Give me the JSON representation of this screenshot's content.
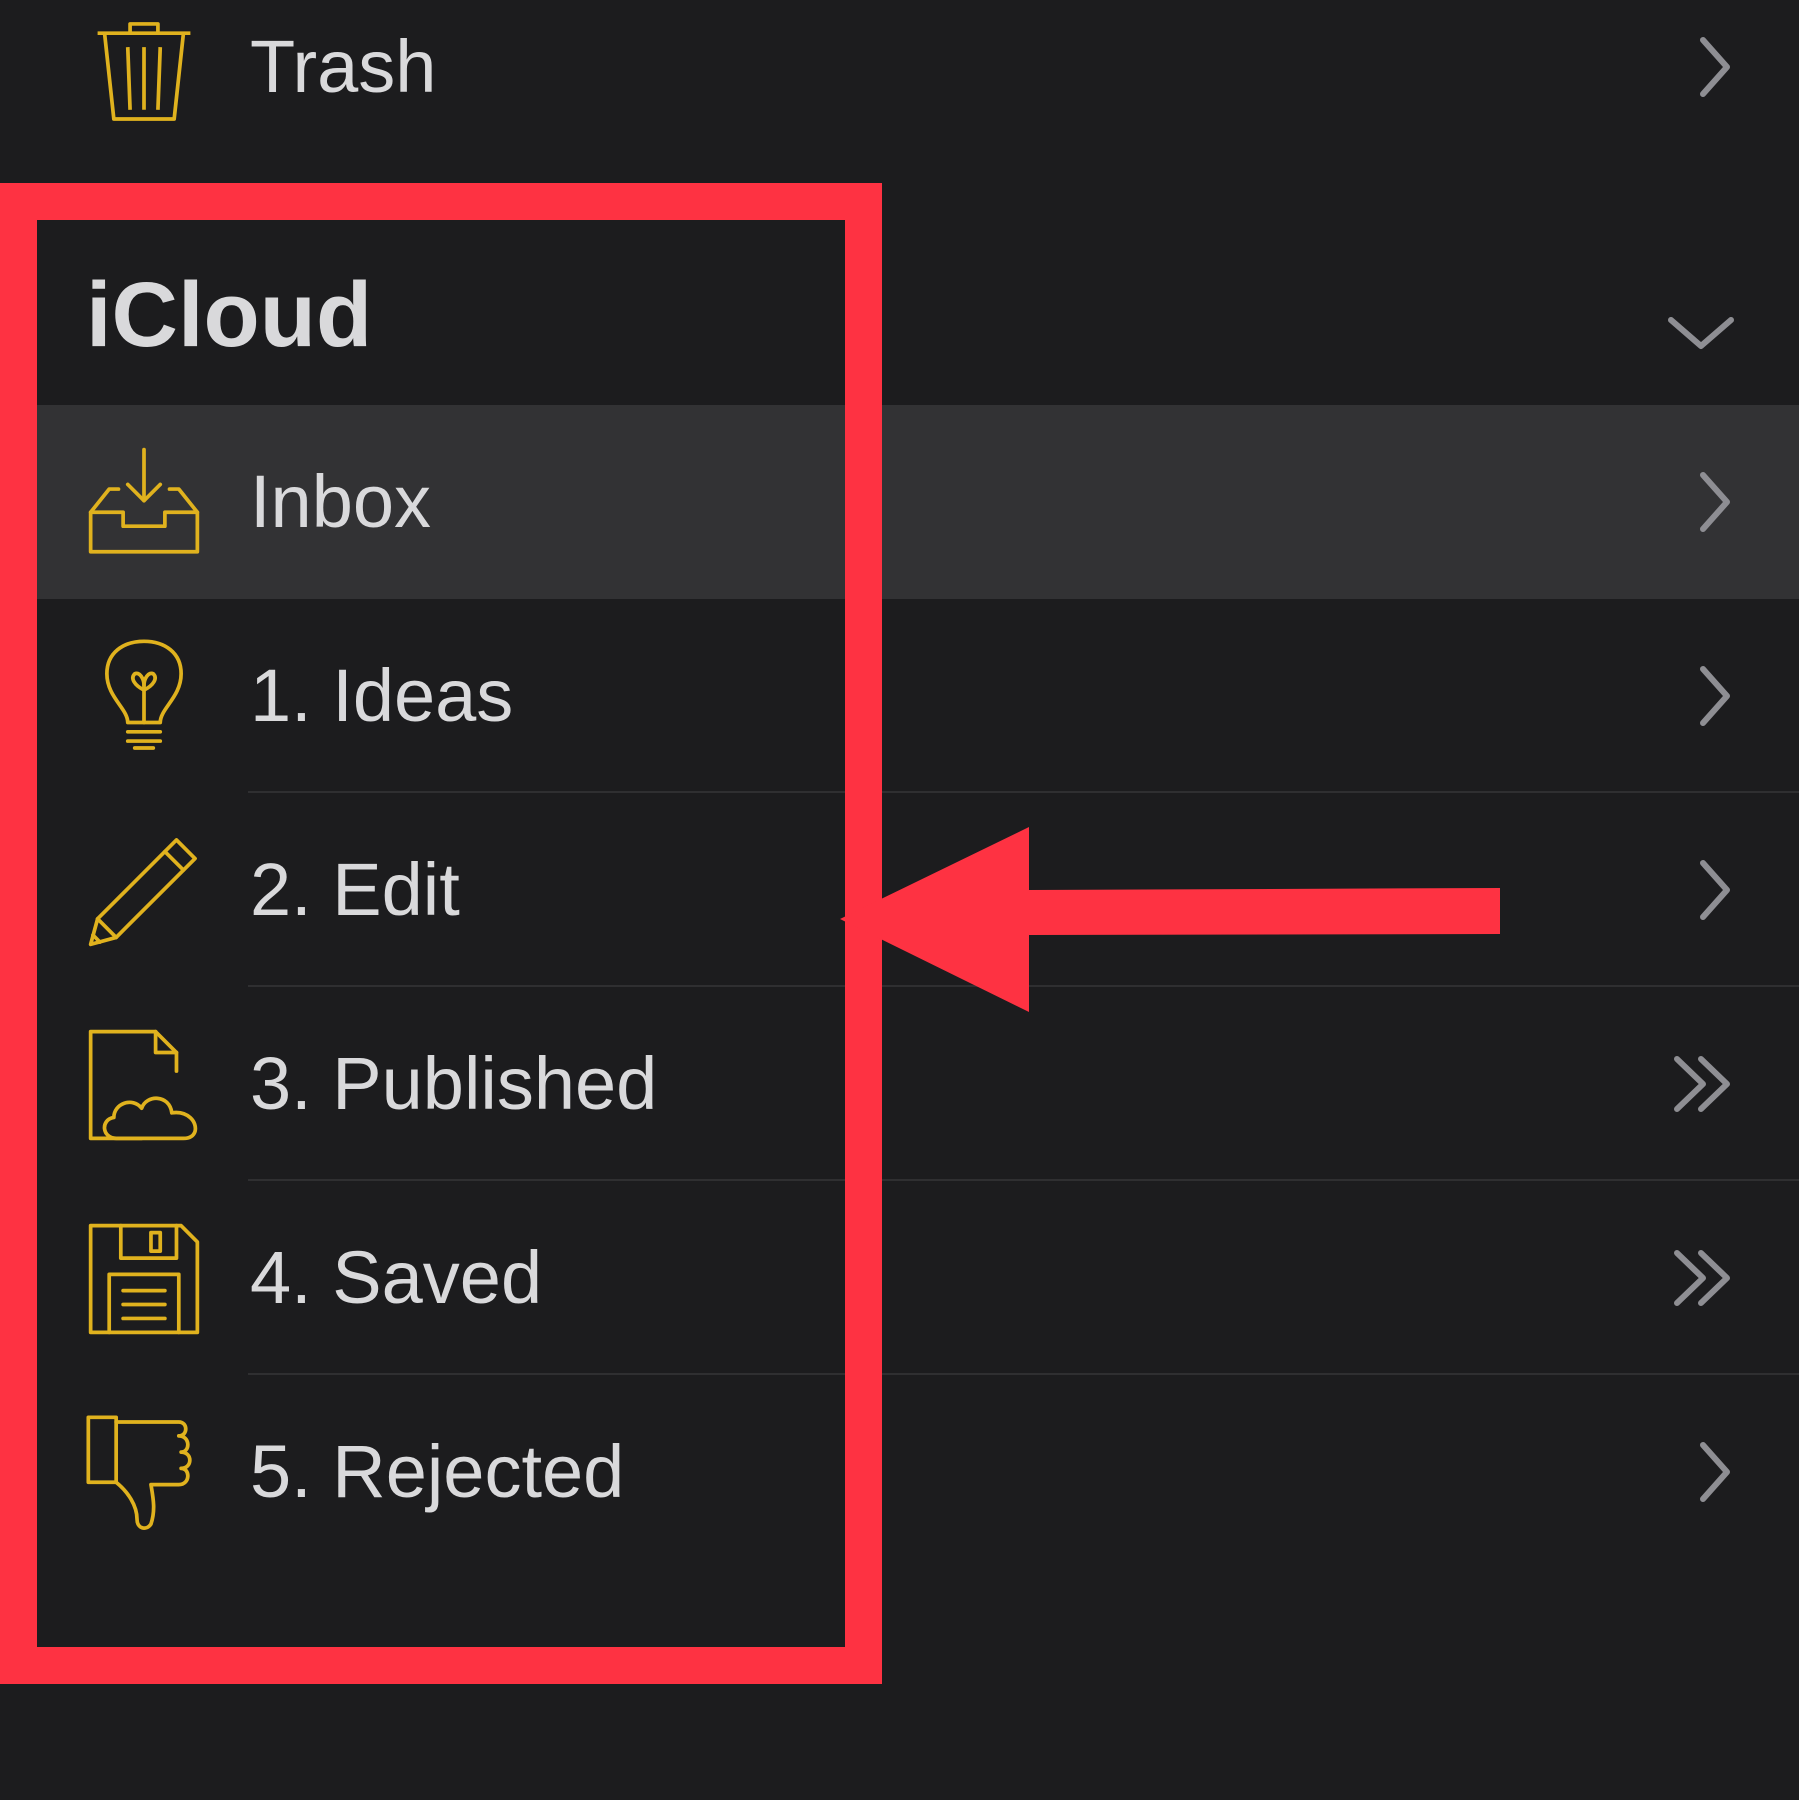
{
  "colors": {
    "background": "#1c1c1e",
    "selected_row": "#323234",
    "icon_accent": "#e0b21e",
    "chevron": "#8e8e93",
    "annotation": "#fe3242"
  },
  "top_row": {
    "label": "Trash",
    "icon": "trash-icon",
    "chevron": "chevron-right-icon"
  },
  "section": {
    "title": "iCloud",
    "chevron": "chevron-down-icon"
  },
  "folders": [
    {
      "label": "Inbox",
      "icon": "inbox-icon",
      "chevron": "chevron-right-icon",
      "selected": true
    },
    {
      "label": "1. Ideas",
      "icon": "lightbulb-icon",
      "chevron": "chevron-right-icon"
    },
    {
      "label": "2. Edit",
      "icon": "pencil-icon",
      "chevron": "chevron-right-icon"
    },
    {
      "label": "3. Published",
      "icon": "cloud-document-icon",
      "chevron": "double-chevron-right-icon"
    },
    {
      "label": "4. Saved",
      "icon": "floppy-disk-icon",
      "chevron": "double-chevron-right-icon"
    },
    {
      "label": "5. Rejected",
      "icon": "thumbs-down-icon",
      "chevron": "chevron-right-icon"
    }
  ],
  "annotation": {
    "box": "highlight-box",
    "arrow": "arrow-left"
  }
}
